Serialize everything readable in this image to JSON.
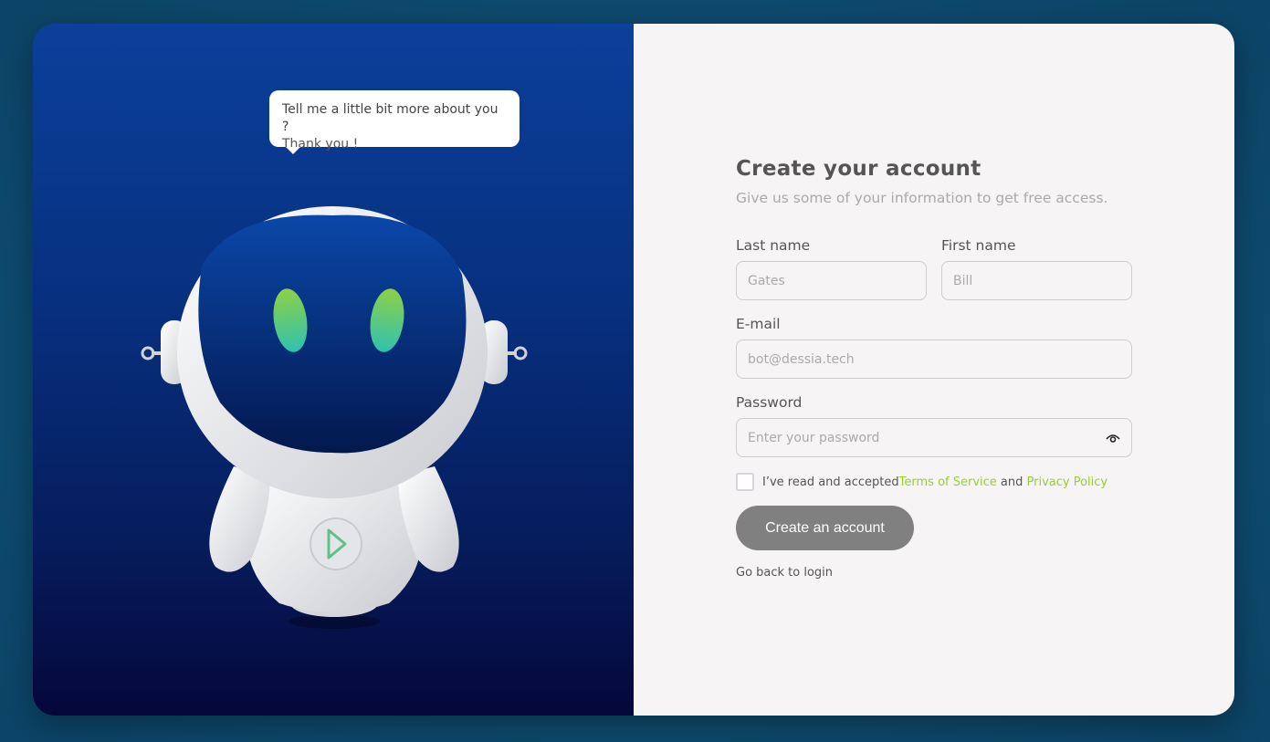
{
  "illustration": {
    "speech_bubble": {
      "line1": "Tell me a little bit more about you ?",
      "line2": "Thank you !"
    }
  },
  "form": {
    "title": "Create your account",
    "subtitle": "Give us some of your information to get free access.",
    "last_name": {
      "label": "Last name",
      "placeholder": "Gates"
    },
    "first_name": {
      "label": "First name",
      "placeholder": "Bill"
    },
    "email": {
      "label": "E-mail",
      "placeholder": "bot@dessia.tech"
    },
    "password": {
      "label": "Password",
      "placeholder": "Enter your password",
      "toggle_icon": "eye-icon"
    },
    "terms": {
      "prefix": "I’ve read and accepted ",
      "terms_link": "Terms of Service",
      "middle": " and ",
      "privacy_link": "Privacy Policy",
      "checked": false
    },
    "submit_label": "Create an account",
    "back_link": "Go back to login"
  },
  "colors": {
    "link": "#9acd32",
    "button": "#808080",
    "panel_top": "#0b409b",
    "panel_bottom": "#05073a"
  }
}
